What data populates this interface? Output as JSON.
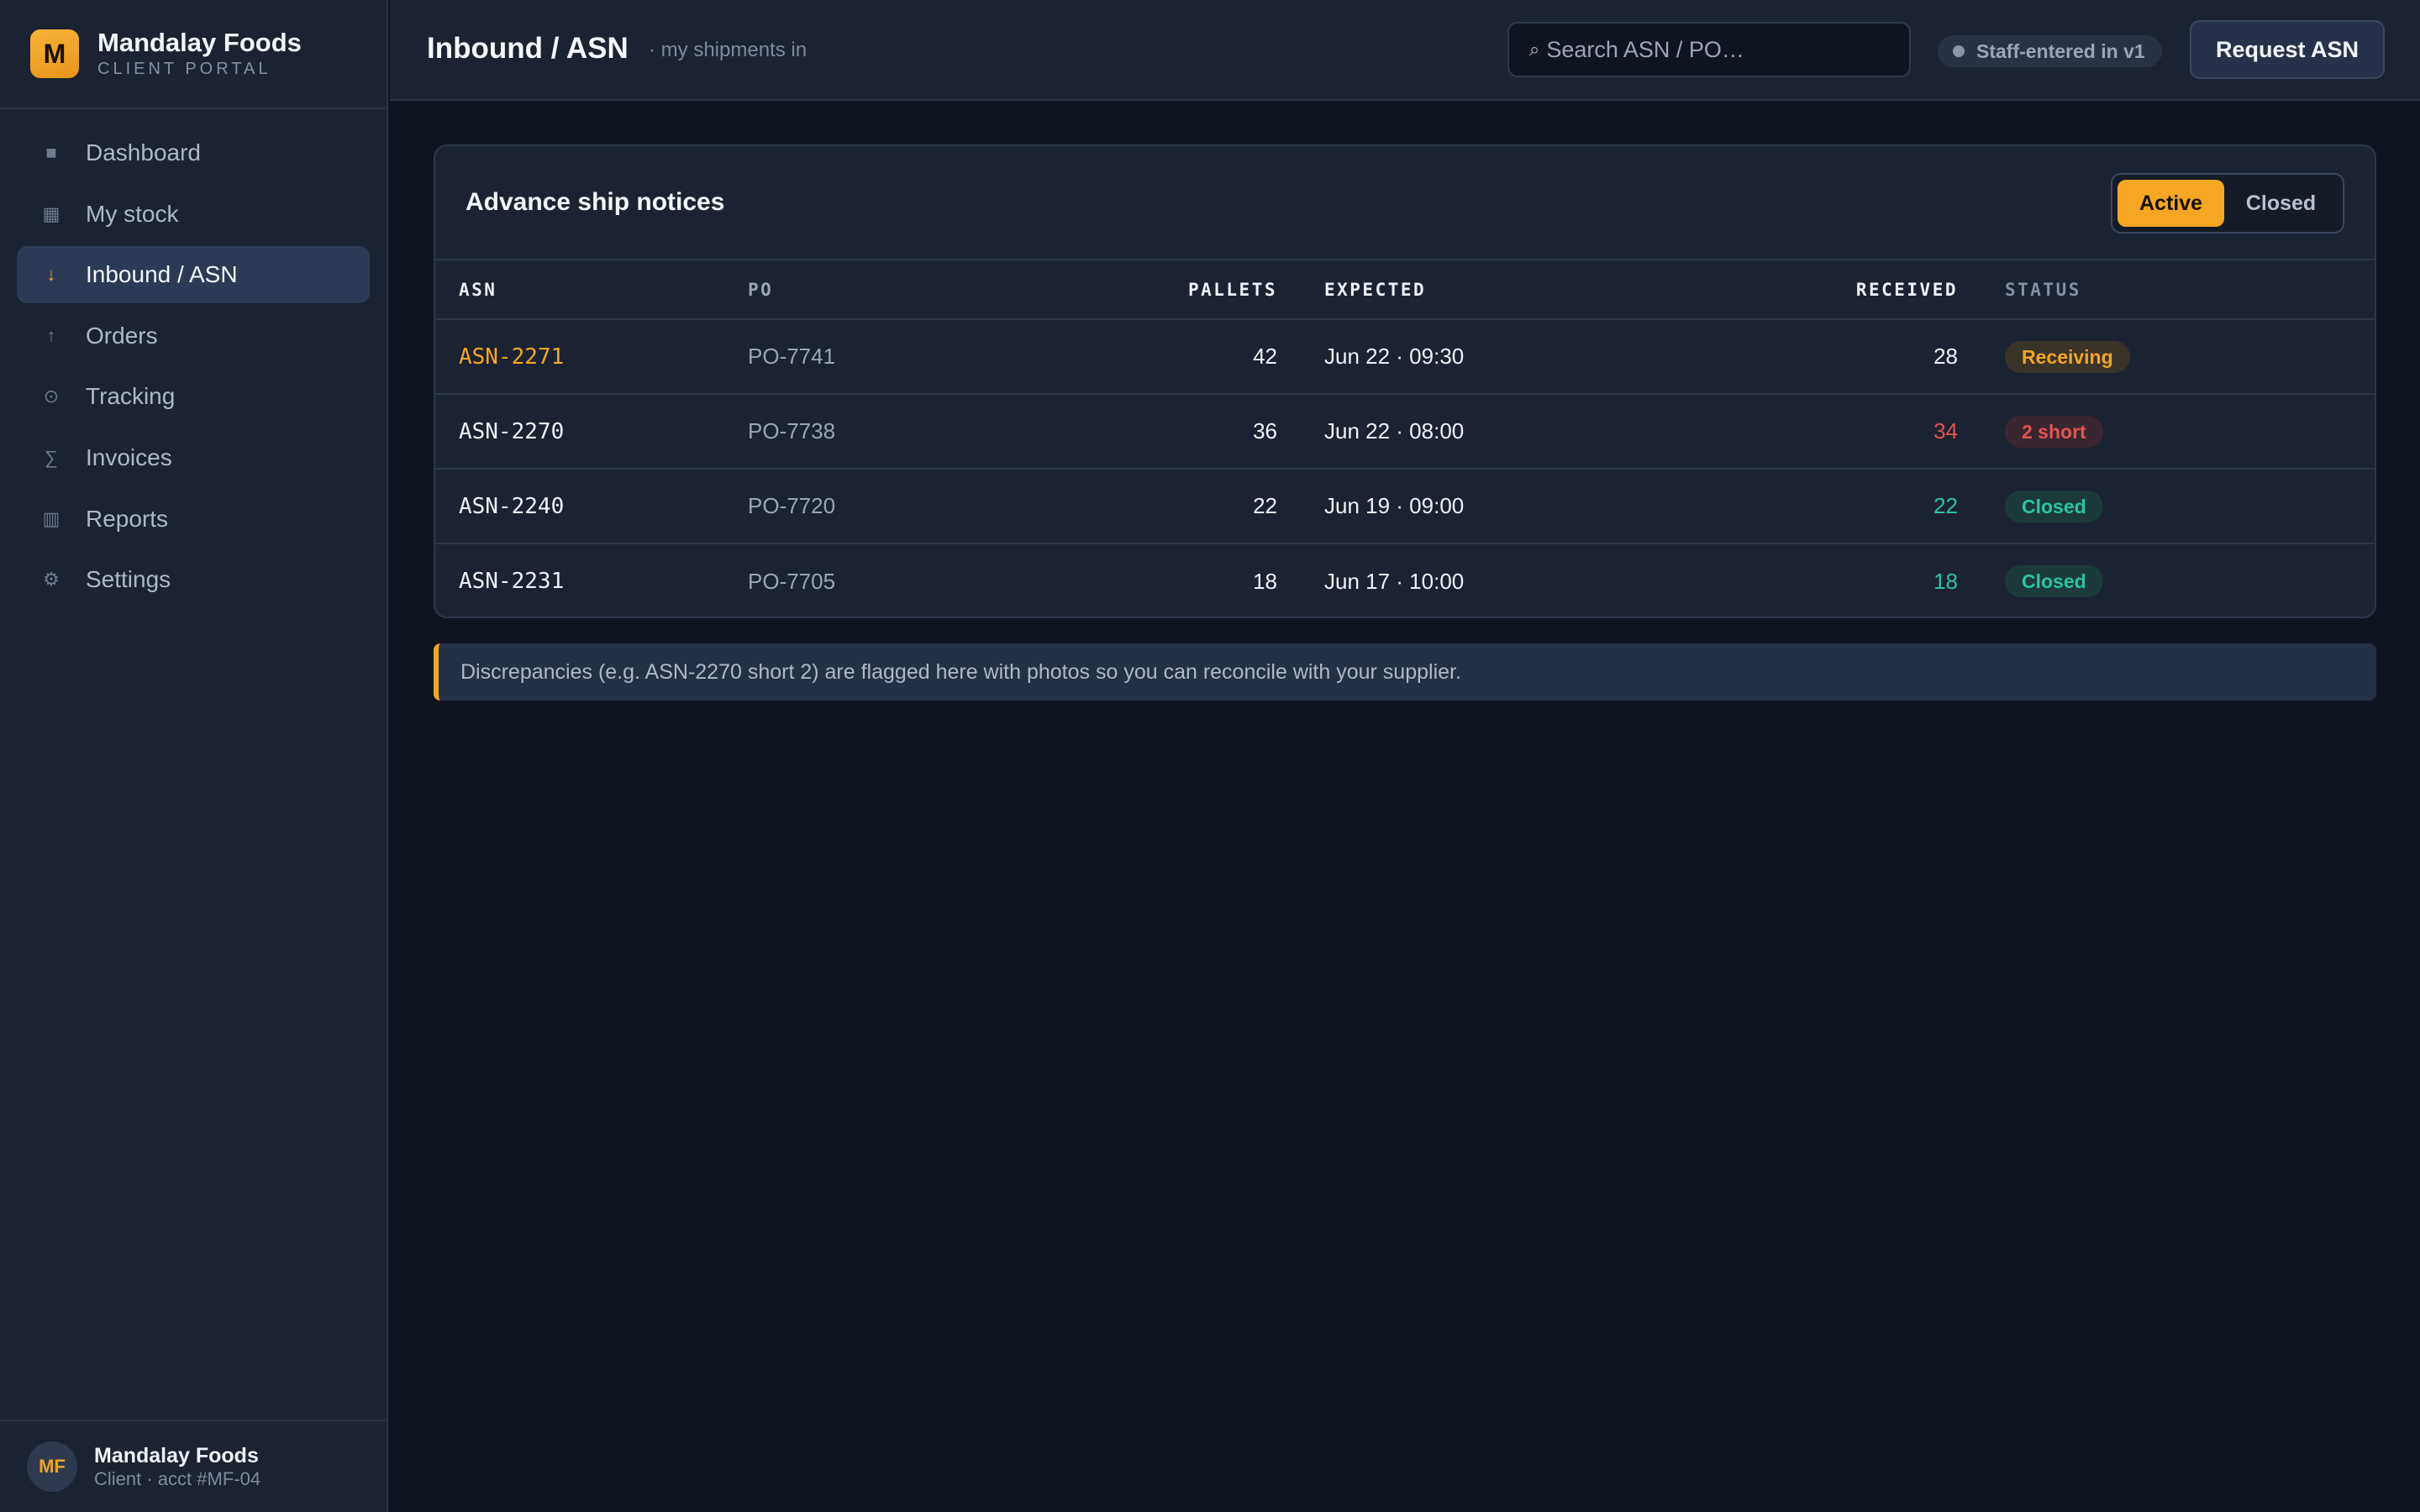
{
  "brand": {
    "logo_letter": "M",
    "name": "Mandalay Foods",
    "subtitle": "CLIENT PORTAL"
  },
  "sidebar": {
    "items": [
      {
        "label": "Dashboard",
        "icon": "■"
      },
      {
        "label": "My stock",
        "icon": "▦"
      },
      {
        "label": "Inbound / ASN",
        "icon": "↓"
      },
      {
        "label": "Orders",
        "icon": "↑"
      },
      {
        "label": "Tracking",
        "icon": "⊙"
      },
      {
        "label": "Invoices",
        "icon": "∑"
      },
      {
        "label": "Reports",
        "icon": "▥"
      },
      {
        "label": "Settings",
        "icon": "⚙"
      }
    ],
    "active_index": 2
  },
  "user": {
    "initials": "MF",
    "name": "Mandalay Foods",
    "subtitle": "Client · acct #MF-04"
  },
  "header": {
    "title": "Inbound / ASN",
    "subtitle": "· my shipments in",
    "search_placeholder": "Search ASN / PO…",
    "staff_label": "Staff-entered in v1",
    "request_button": "Request ASN"
  },
  "card": {
    "title": "Advance ship notices",
    "filters": {
      "active": "Active",
      "closed": "Closed"
    },
    "columns": {
      "asn": "ASN",
      "po": "PO",
      "pallets": "PALLETS",
      "expected": "EXPECTED",
      "received": "RECEIVED",
      "status": "STATUS"
    },
    "rows": [
      {
        "asn": "ASN-2271",
        "po": "PO-7741",
        "pallets": "42",
        "expected": "Jun 22 · 09:30",
        "received": "28",
        "status": "Receiving"
      },
      {
        "asn": "ASN-2270",
        "po": "PO-7738",
        "pallets": "36",
        "expected": "Jun 22 · 08:00",
        "received": "34",
        "status": "2 short"
      },
      {
        "asn": "ASN-2240",
        "po": "PO-7720",
        "pallets": "22",
        "expected": "Jun 19 · 09:00",
        "received": "22",
        "status": "Closed"
      },
      {
        "asn": "ASN-2231",
        "po": "PO-7705",
        "pallets": "18",
        "expected": "Jun 17 · 10:00",
        "received": "18",
        "status": "Closed"
      }
    ]
  },
  "note": "Discrepancies (e.g. ASN-2270 short 2) are flagged here with photos so you can reconcile with your supplier.",
  "colors": {
    "accent": "#f5a623",
    "danger": "#e0544f",
    "success": "#2bc4a0",
    "bg": "#0f1520",
    "panel": "#1b2332"
  }
}
